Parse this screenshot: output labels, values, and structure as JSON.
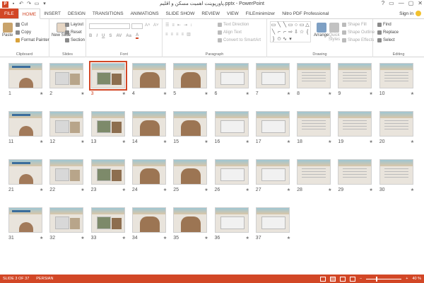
{
  "titlebar": {
    "title": "پاورپوینت اهمیت مسکن و اقلیم.pptx - PowerPoint",
    "app_icon": "P",
    "controls": [
      "?",
      "▭",
      "—",
      "▢",
      "✕"
    ]
  },
  "tabs": [
    "FILE",
    "HOME",
    "INSERT",
    "DESIGN",
    "TRANSITIONS",
    "ANIMATIONS",
    "SLIDE SHOW",
    "REVIEW",
    "VIEW",
    "FILEminimizer",
    "Nitro PDF Professional"
  ],
  "signin": "Sign in",
  "ribbon": {
    "clipboard": {
      "label": "Clipboard",
      "paste": "Paste",
      "cut": "Cut",
      "copy": "Copy",
      "format_painter": "Format Painter"
    },
    "slides": {
      "label": "Slides",
      "new_slide": "New Slide",
      "layout": "Layout",
      "reset": "Reset",
      "section": "Section"
    },
    "font": {
      "label": "Font"
    },
    "paragraph": {
      "label": "Paragraph",
      "text_direction": "Text Direction",
      "align_text": "Align Text",
      "smartart": "Convert to SmartArt"
    },
    "drawing": {
      "label": "Drawing",
      "arrange": "Arrange",
      "quick_styles": "Quick Styles",
      "shape_fill": "Shape Fill",
      "shape_outline": "Shape Outline",
      "shape_effects": "Shape Effects"
    },
    "editing": {
      "label": "Editing",
      "find": "Find",
      "replace": "Replace",
      "select": "Select"
    }
  },
  "slides": [
    {
      "num": "1"
    },
    {
      "num": "2"
    },
    {
      "num": "3"
    },
    {
      "num": "4"
    },
    {
      "num": "5"
    },
    {
      "num": "6"
    },
    {
      "num": "7"
    },
    {
      "num": "8"
    },
    {
      "num": "9"
    },
    {
      "num": "10"
    },
    {
      "num": "11"
    },
    {
      "num": "12"
    },
    {
      "num": "13"
    },
    {
      "num": "14"
    },
    {
      "num": "15"
    },
    {
      "num": "16"
    },
    {
      "num": "17"
    },
    {
      "num": "18"
    },
    {
      "num": "19"
    },
    {
      "num": "20"
    },
    {
      "num": "21"
    },
    {
      "num": "22"
    },
    {
      "num": "23"
    },
    {
      "num": "24"
    },
    {
      "num": "25"
    },
    {
      "num": "26"
    },
    {
      "num": "27"
    },
    {
      "num": "28"
    },
    {
      "num": "29"
    },
    {
      "num": "30"
    },
    {
      "num": "31"
    },
    {
      "num": "32"
    },
    {
      "num": "33"
    },
    {
      "num": "34"
    },
    {
      "num": "35"
    },
    {
      "num": "36"
    },
    {
      "num": "37"
    }
  ],
  "selected_slide": "3",
  "star": "★",
  "status": {
    "slide_info": "SLIDE 3 OF 37",
    "language": "PERSIAN",
    "zoom": "40 %"
  },
  "colors": {
    "accent": "#d24726"
  }
}
